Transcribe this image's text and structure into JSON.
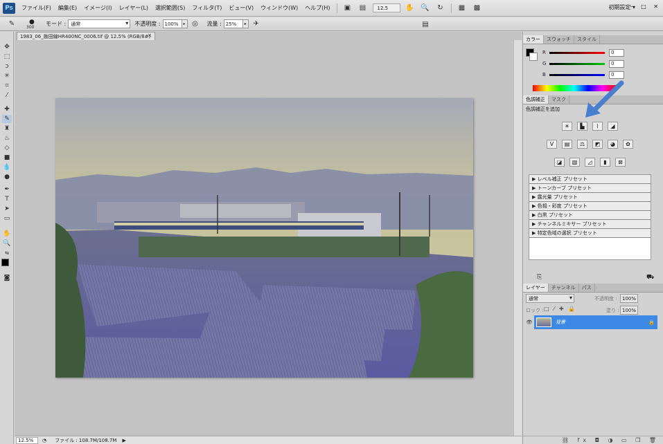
{
  "app": {
    "logo": "Ps",
    "workspace": "初期設定 ▾",
    "window_buttons": "─ □ ✕"
  },
  "menu": [
    "ファイル(F)",
    "編集(E)",
    "イメージ(I)",
    "レイヤー(L)",
    "選択範囲(S)",
    "フィルタ(T)",
    "ビュー(V)",
    "ウィンドウ(W)",
    "ヘルプ(H)"
  ],
  "menubar": {
    "zoom": "12.5"
  },
  "options": {
    "brush_size": "300",
    "mode_label": "モード :",
    "mode_value": "通常",
    "opacity_label": "不透明度 :",
    "opacity_value": "100%",
    "flow_label": "流量 :",
    "flow_value": "25%"
  },
  "document": {
    "tab_title": "1983_06_飯田線HR400NC_0006.tif @ 12.5% (RGB/8#)",
    "close": "×"
  },
  "status": {
    "zoom": "12.5%",
    "file_info": "ファイル : 108.7M/108.7M"
  },
  "color_panel": {
    "tabs": [
      "カラー",
      "スウォッチ",
      "スタイル"
    ],
    "channels": [
      {
        "label": "R",
        "value": "0"
      },
      {
        "label": "G",
        "value": "0"
      },
      {
        "label": "B",
        "value": "0"
      }
    ]
  },
  "adjust_panel": {
    "tabs": [
      "色調補正",
      "マスク"
    ],
    "title": "色調補正を追加",
    "presets": [
      "レベル補正 プリセット",
      "トーンカーブ プリセット",
      "露光量 プリセット",
      "色相・彩度 プリセット",
      "白黒 プリセット",
      "チャンネルミキサー プリセット",
      "特定色域の選択 プリセット"
    ]
  },
  "layers_panel": {
    "tabs": [
      "レイヤー",
      "チャンネル",
      "パス"
    ],
    "blend_mode": "通常",
    "opacity_label": "不透明度 :",
    "opacity_value": "100%",
    "lock_label": "ロック :",
    "fill_label": "塗り :",
    "fill_value": "100%",
    "layer_name": "背景"
  },
  "colors": {
    "accent": "#3d8ae6",
    "layer_selected": "#3d8ae6",
    "panel_bg": "#d2d2d2"
  }
}
